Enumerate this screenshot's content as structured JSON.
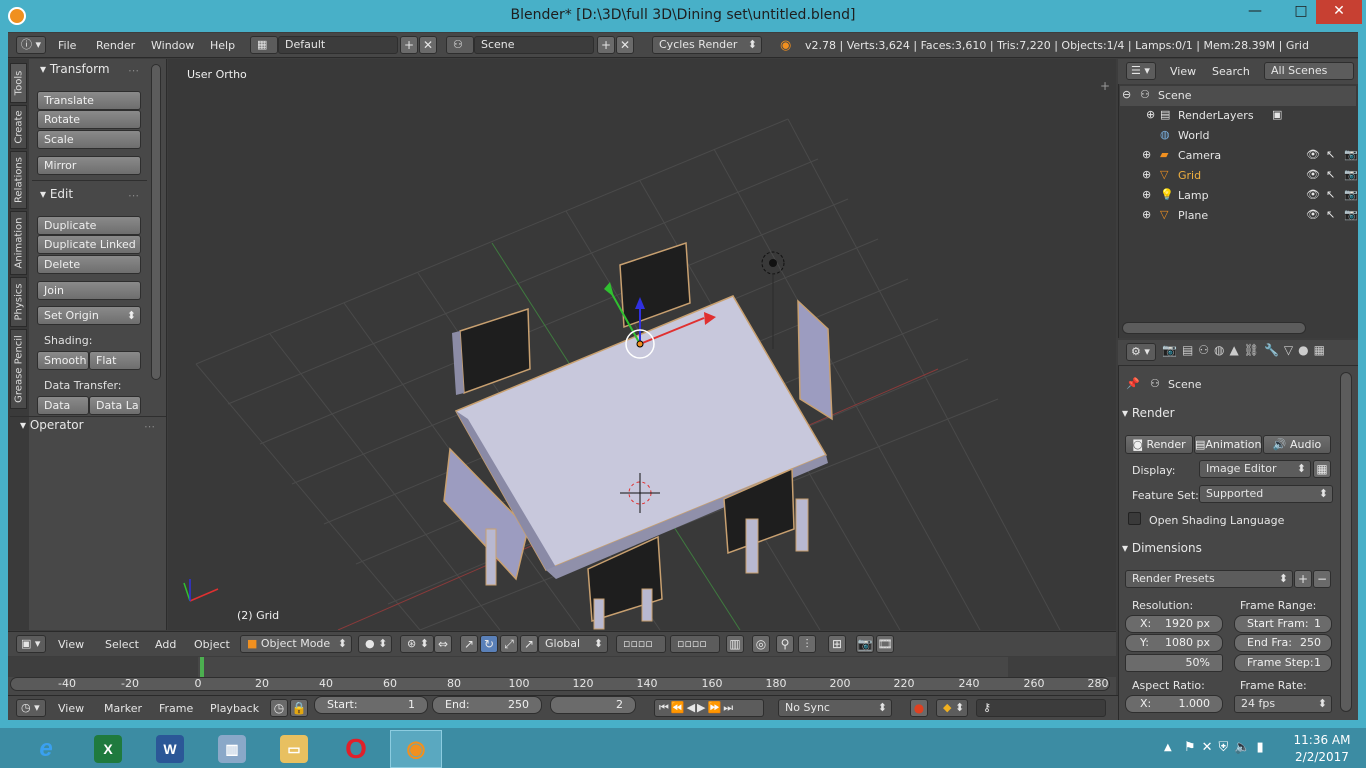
{
  "window": {
    "title": "Blender* [D:\\3D\\full 3D\\Dining set\\untitled.blend]",
    "minimize": "—",
    "maximize": "□",
    "close": "✕"
  },
  "info_header": {
    "menus": [
      "File",
      "Render",
      "Window",
      "Help"
    ],
    "layout": "Default",
    "scene": "Scene",
    "engine": "Cycles Render",
    "stats": "v2.78 | Verts:3,624 | Faces:3,610 | Tris:7,220 | Objects:1/4 | Lamps:0/1 | Mem:28.39M | Grid"
  },
  "tool_shelf": {
    "tabs": [
      "Tools",
      "Create",
      "Relations",
      "Animation",
      "Physics",
      "Grease Pencil"
    ],
    "transform_header": "Transform",
    "transform_buttons": [
      "Translate",
      "Rotate",
      "Scale"
    ],
    "mirror": "Mirror",
    "edit_header": "Edit",
    "edit_buttons": [
      "Duplicate",
      "Duplicate Linked",
      "Delete"
    ],
    "join": "Join",
    "set_origin": "Set Origin",
    "shading_label": "Shading:",
    "smooth": "Smooth",
    "flat": "Flat",
    "data_transfer_label": "Data Transfer:",
    "data": "Data",
    "data_layout": "Data La",
    "operator_header": "Operator"
  },
  "viewport": {
    "view_label": "User Ortho",
    "object_label": "(2) Grid"
  },
  "view3d_header": {
    "menus": [
      "View",
      "Select",
      "Add",
      "Object"
    ],
    "mode": "Object Mode",
    "orientation": "Global"
  },
  "timeline": {
    "ticks": [
      "-40",
      "-20",
      "0",
      "20",
      "40",
      "60",
      "80",
      "100",
      "120",
      "140",
      "160",
      "180",
      "200",
      "220",
      "240",
      "260",
      "280"
    ],
    "menus": [
      "View",
      "Marker",
      "Frame",
      "Playback"
    ],
    "start_label": "Start:",
    "start_value": "1",
    "end_label": "End:",
    "end_value": "250",
    "current_frame": "2",
    "sync": "No Sync"
  },
  "outliner": {
    "menus": [
      "View",
      "Search"
    ],
    "filter": "All Scenes",
    "items": [
      "Scene",
      "RenderLayers",
      "World",
      "Camera",
      "Grid",
      "Lamp",
      "Plane"
    ]
  },
  "properties": {
    "context": "Scene",
    "render_header": "Render",
    "render_btn": "Render",
    "animation_btn": "Animation",
    "audio_btn": "Audio",
    "display_label": "Display:",
    "display_value": "Image Editor",
    "feature_set_label": "Feature Set:",
    "feature_set_value": "Supported",
    "osl_label": "Open Shading Language",
    "dimensions_header": "Dimensions",
    "render_presets": "Render Presets",
    "resolution_label": "Resolution:",
    "res_x": "X:",
    "res_x_val": "1920 px",
    "res_y": "Y:",
    "res_y_val": "1080 px",
    "res_pct": "50%",
    "frame_range_label": "Frame Range:",
    "start_frame": "Start Fram:",
    "start_frame_val": "1",
    "end_frame": "End Fra:",
    "end_frame_val": "250",
    "frame_step": "Frame Step:",
    "frame_step_val": "1",
    "aspect_label": "Aspect Ratio:",
    "aspect_x": "X:",
    "aspect_x_val": "1.000",
    "frame_rate_label": "Frame Rate:",
    "frame_rate_val": "24 fps"
  },
  "taskbar": {
    "time": "11:36 AM",
    "date": "2/2/2017"
  }
}
